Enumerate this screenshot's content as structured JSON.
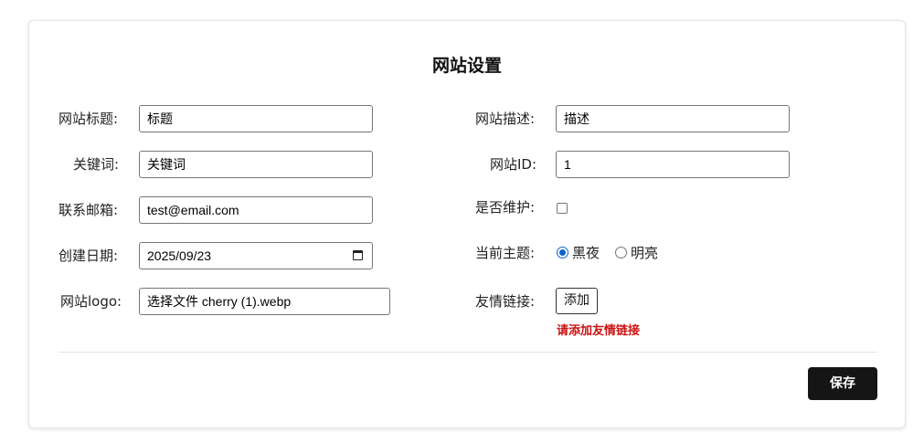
{
  "page": {
    "title": "网站设置"
  },
  "left_fields": {
    "site_title": {
      "label": "网站标题:",
      "value": "标题"
    },
    "keywords": {
      "label": "关键词:",
      "value": "关键词"
    },
    "email": {
      "label": "联系邮箱:",
      "value": "test@email.com"
    },
    "created_date": {
      "label": "创建日期:",
      "value": "2025/09/23",
      "icon": "calendar-icon"
    },
    "logo": {
      "label": "网站logo:",
      "value": "选择文件 cherry (1).webp"
    }
  },
  "right_fields": {
    "description": {
      "label": "网站描述:",
      "value": "描述"
    },
    "site_id": {
      "label": "网站ID:",
      "value": "1"
    },
    "maintenance": {
      "label": "是否维护:",
      "checked": false
    },
    "theme": {
      "label": "当前主题:",
      "options": [
        "黑夜",
        "明亮"
      ],
      "selected": "黑夜"
    },
    "friend_links": {
      "label": "友情链接:",
      "add_label": "添加",
      "error": "请添加友情链接"
    }
  },
  "footer": {
    "save_label": "保存"
  },
  "colors": {
    "save_button_bg": "#151515",
    "error_text": "#cc1111",
    "radio_accent": "#0a64c8"
  }
}
